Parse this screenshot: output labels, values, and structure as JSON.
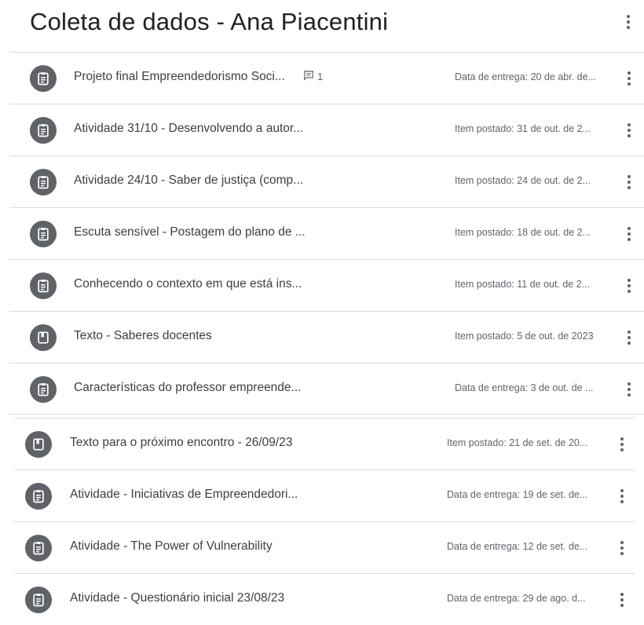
{
  "header": {
    "title": "Coleta de dados - Ana Piacentini"
  },
  "items": [
    {
      "icon": "assignment-icon",
      "name": "Projeto final Empreendedorismo Soci...",
      "comments": "1",
      "meta": "Data de entrega: 20 de abr. de..."
    },
    {
      "icon": "assignment-icon",
      "name": "Atividade 31/10 - Desenvolvendo a autor...",
      "meta": "Item postado: 31 de out. de 2..."
    },
    {
      "icon": "assignment-icon",
      "name": "Atividade 24/10 - Saber de justiça (comp...",
      "meta": "Item postado: 24 de out. de 2..."
    },
    {
      "icon": "assignment-icon",
      "name": "Escuta sensível - Postagem do plano de ...",
      "meta": "Item postado: 18 de out. de 2..."
    },
    {
      "icon": "assignment-icon",
      "name": "Conhecendo o contexto em que está ins...",
      "meta": "Item postado: 11 de out. de 2..."
    },
    {
      "icon": "book-icon",
      "name": "Texto - Saberes docentes",
      "meta": "Item postado: 5 de out. de 2023"
    },
    {
      "icon": "assignment-icon",
      "name": "Características do professor empreende...",
      "meta": "Data de entrega: 3 de out. de ..."
    },
    {
      "icon": "book-icon",
      "name": "Texto para o próximo encontro - 26/09/23",
      "meta": "Item postado: 21 de set. de 20..."
    },
    {
      "icon": "assignment-icon",
      "name": "Atividade - Iniciativas de Empreendedori...",
      "meta": "Data de entrega: 19 de set. de..."
    },
    {
      "icon": "assignment-icon",
      "name": "Atividade - The Power of Vulnerability",
      "meta": "Data de entrega: 12 de set. de..."
    },
    {
      "icon": "assignment-icon",
      "name": "Atividade - Questionário inicial 23/08/23",
      "meta": "Data de entrega: 29 de ago. d..."
    }
  ]
}
